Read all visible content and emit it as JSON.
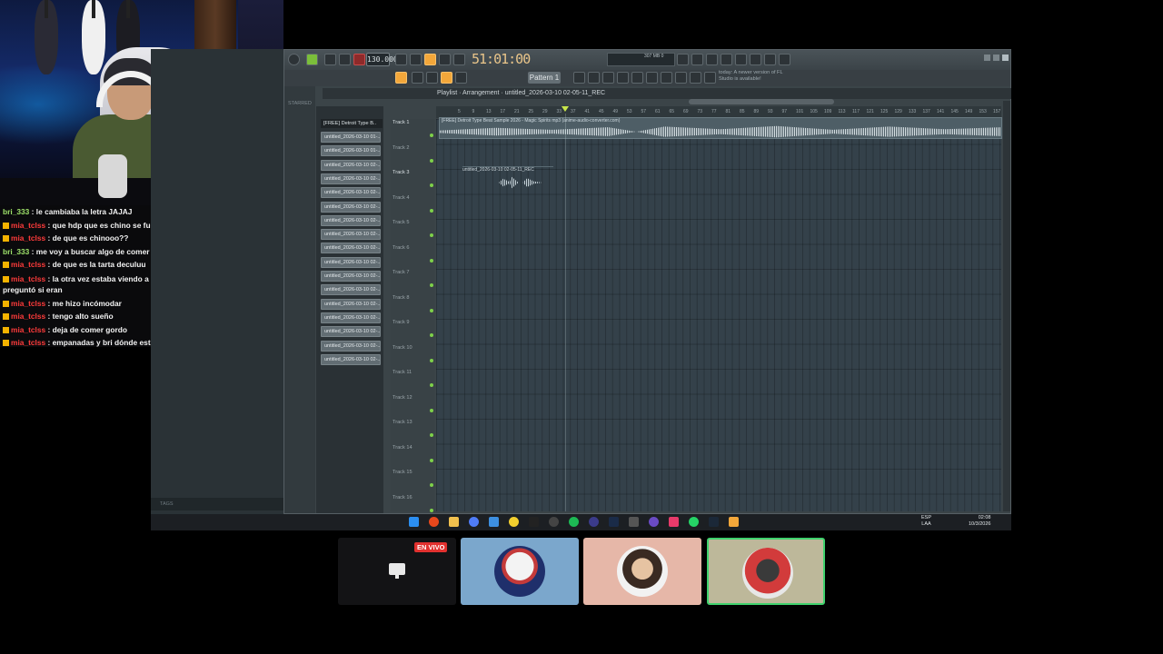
{
  "chat": {
    "messages": [
      {
        "user": "bri_333",
        "user_color": "green",
        "text": " : le cambiaba la letra JAJAJ",
        "badge": false
      },
      {
        "user": "mia_tclss",
        "user_color": "red",
        "text": " : que hdp que es chino se fue a mat*r de risa seguro",
        "badge": true
      },
      {
        "user": "mia_tclss",
        "user_color": "red",
        "text": " : de que es chinooo??",
        "badge": true
      },
      {
        "user": "bri_333",
        "user_color": "green",
        "text": " : me voy a buscar algo de comer me dio hambre el chino..",
        "badge": false
      },
      {
        "user": "mia_tclss",
        "user_color": "red",
        "text": " : de que es la tarta deculuu",
        "badge": true
      },
      {
        "user": "mia_tclss",
        "user_color": "red",
        "text": " : la otra vez estaba viendo a los mernosketti y mi mamá me preguntó si eran",
        "badge": true
      },
      {
        "user": "mia_tclss",
        "user_color": "red",
        "text": " : me hizo incómodar",
        "badge": true
      },
      {
        "user": "mia_tclss",
        "user_color": "red",
        "text": " : tengo alto sueño",
        "badge": true
      },
      {
        "user": "mia_tclss",
        "user_color": "red",
        "text": " : deja de comer gordo",
        "badge": true
      },
      {
        "user": "mia_tclss",
        "user_color": "red",
        "text": " : empanadas y bri dónde están hableen",
        "badge": true
      }
    ]
  },
  "fl": {
    "bpm": "130.000",
    "song_time": "51:01:00",
    "pattern": "Pattern 1",
    "update_notice": "today: A newer version of FL Studio is available!",
    "cpu": "307 MB 0",
    "playlist_title": "Playlist · Arrangement · untitled_2026-03-10 02-05-11_REC",
    "browser_label": "STARRED",
    "channel_title": "[FREE] Detroit Type B..",
    "channels": [
      "untitled_2026-03-10 01-..",
      "untitled_2026-03-10 01-..",
      "untitled_2026-03-10 02-..",
      "untitled_2026-03-10 02-..",
      "untitled_2026-03-10 02-..",
      "untitled_2026-03-10 02-..",
      "untitled_2026-03-10 02-..",
      "untitled_2026-03-10 02-..",
      "untitled_2026-03-10 02-..",
      "untitled_2026-03-10 02-..",
      "untitled_2026-03-10 02-..",
      "untitled_2026-03-10 02-..",
      "untitled_2026-03-10 02-..",
      "untitled_2026-03-10 02-..",
      "untitled_2026-03-10 02-..",
      "untitled_2026-03-10 02-..",
      "untitled_2026-03-10 02-.."
    ],
    "tracks": [
      "Track 1",
      "Track 2",
      "Track 3",
      "Track 4",
      "Track 5",
      "Track 6",
      "Track 7",
      "Track 8",
      "Track 9",
      "Track 10",
      "Track 11",
      "Track 12",
      "Track 13",
      "Track 14",
      "Track 15",
      "Track 16"
    ],
    "clip_main": "[FREE] Detroit Type Beat Sample 2026 - Magic Spirits mp3 (anime-audio-converter.com)",
    "clip_rec": "untitled_2026-03-10 02-05-11_REC",
    "tags_label": "TAGS",
    "ruler": [
      "5",
      "9",
      "13",
      "17",
      "21",
      "25",
      "29",
      "33",
      "37",
      "41",
      "45",
      "49",
      "53",
      "57",
      "61",
      "65",
      "69",
      "73",
      "77",
      "81",
      "85",
      "89",
      "93",
      "97",
      "101",
      "105",
      "109",
      "113",
      "117",
      "121",
      "125",
      "129",
      "133",
      "137",
      "141",
      "145",
      "149",
      "153",
      "157"
    ]
  },
  "taskbar": {
    "lang": "ESP\nLAA",
    "time": "02:08",
    "date": "10/3/2026"
  },
  "participants": {
    "live_label": "EN VIVO"
  },
  "colors": {
    "accent_orange": "#f3a73a",
    "live_red": "#e2312f",
    "speaking_green": "#3fd26d",
    "chat_user_green": "#9fe36b",
    "chat_user_red": "#ff3b3b"
  }
}
